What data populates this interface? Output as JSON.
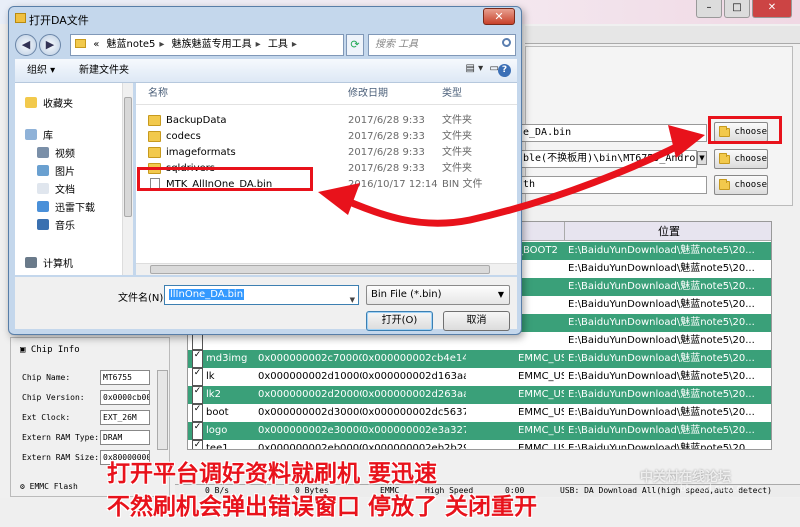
{
  "tool": {
    "table_header_location": "位置",
    "fields": [
      {
        "value": "e_DA.bin"
      },
      {
        "value": "ble(不换板用)\\bin\\MT6755_Android_scat"
      },
      {
        "value": "th"
      }
    ],
    "choose_label": "choose",
    "rows": [
      {
        "checked": false,
        "name": "",
        "begin": "",
        "end": "",
        "region": "_BOOT2",
        "location": "E:\\BaiduYunDownload\\魅蓝note5\\20..."
      },
      {
        "checked": false,
        "name": "",
        "begin": "",
        "end": "",
        "region": "",
        "location": "E:\\BaiduYunDownload\\魅蓝note5\\20..."
      },
      {
        "checked": false,
        "name": "",
        "begin": "",
        "end": "",
        "region": "",
        "location": "E:\\BaiduYunDownload\\魅蓝note5\\20..."
      },
      {
        "checked": false,
        "name": "",
        "begin": "",
        "end": "",
        "region": "",
        "location": "E:\\BaiduYunDownload\\魅蓝note5\\20..."
      },
      {
        "checked": false,
        "name": "",
        "begin": "",
        "end": "",
        "region": "",
        "location": "E:\\BaiduYunDownload\\魅蓝note5\\20..."
      },
      {
        "checked": false,
        "name": "",
        "begin": "",
        "end": "",
        "region": "",
        "location": "E:\\BaiduYunDownload\\魅蓝note5\\20..."
      },
      {
        "checked": true,
        "name": "md3img",
        "begin": "0x000000002c700000",
        "end": "0x000000002cb4e14f",
        "region": "EMMC_USER",
        "location": "E:\\BaiduYunDownload\\魅蓝note5\\20..."
      },
      {
        "checked": true,
        "name": "lk",
        "begin": "0x000000002d100000",
        "end": "0x000000002d163aaf",
        "region": "EMMC_USER",
        "location": "E:\\BaiduYunDownload\\魅蓝note5\\20..."
      },
      {
        "checked": true,
        "name": "lk2",
        "begin": "0x000000002d200000",
        "end": "0x000000002d263aaf",
        "region": "EMMC_USER",
        "location": "E:\\BaiduYunDownload\\魅蓝note5\\20..."
      },
      {
        "checked": true,
        "name": "boot",
        "begin": "0x000000002d300000",
        "end": "0x000000002dc5637f",
        "region": "EMMC_USER",
        "location": "E:\\BaiduYunDownload\\魅蓝note5\\20..."
      },
      {
        "checked": true,
        "name": "logo",
        "begin": "0x000000002e300000",
        "end": "0x000000002e3a327f",
        "region": "EMMC_USER",
        "location": "E:\\BaiduYunDownload\\魅蓝note5\\20..."
      },
      {
        "checked": true,
        "name": "tee1",
        "begin": "0x000000002eb00000",
        "end": "0x000000002eb2b29f",
        "region": "EMMC_USER",
        "location": "E:\\BaiduYunDownload\\魅蓝note5\\20..."
      }
    ],
    "chip_info": {
      "header": "Chip Info",
      "items": [
        {
          "label": "Chip Name:",
          "value": "MT6755"
        },
        {
          "label": "Chip Version:",
          "value": "0x0000cb00"
        },
        {
          "label": "Ext Clock:",
          "value": "EXT_26M"
        },
        {
          "label": "Extern RAM Type:",
          "value": "DRAM"
        },
        {
          "label": "Extern RAM Size:",
          "value": "0x80000000"
        }
      ],
      "emmc_label": "EMMC Flash"
    },
    "status": {
      "s1": "0 B/s",
      "s2": "0 Bytes",
      "s3": "EMMC",
      "s4": "High Speed",
      "s5": "0:00",
      "s6": "USB: DA Download All(high speed,auto detect)"
    }
  },
  "dialog": {
    "title": "打开DA文件",
    "breadcrumb": [
      "«",
      "魅蓝note5",
      "魅族魅蓝专用工具",
      "工具"
    ],
    "search_placeholder": "搜索 工具",
    "toolbar": {
      "organize": "组织 ▾",
      "new_folder": "新建文件夹"
    },
    "nav_items": [
      {
        "label": "收藏夹",
        "color": "#f2c94c"
      },
      {
        "label": "库",
        "color": "#8fb2d8"
      },
      {
        "label": "视频",
        "color": "#7a8fa8"
      },
      {
        "label": "图片",
        "color": "#6aa0d0"
      },
      {
        "label": "文档",
        "color": "#e0e6ee"
      },
      {
        "label": "迅雷下载",
        "color": "#4a90d9"
      },
      {
        "label": "音乐",
        "color": "#3a70b0"
      },
      {
        "label": "计算机",
        "color": "#6a7a8a"
      }
    ],
    "columns": {
      "name": "名称",
      "date": "修改日期",
      "type": "类型"
    },
    "files": [
      {
        "name": "BackupData",
        "date": "2017/6/28 9:33",
        "type": "文件夹",
        "kind": "folder"
      },
      {
        "name": "codecs",
        "date": "2017/6/28 9:33",
        "type": "文件夹",
        "kind": "folder"
      },
      {
        "name": "imageformats",
        "date": "2017/6/28 9:33",
        "type": "文件夹",
        "kind": "folder"
      },
      {
        "name": "sqldrivers",
        "date": "2017/6/28 9:33",
        "type": "文件夹",
        "kind": "folder"
      },
      {
        "name": "MTK_AllInOne_DA.bin",
        "date": "2016/10/17 12:14",
        "type": "BIN 文件",
        "kind": "file"
      }
    ],
    "filename_label": "文件名(N):",
    "filename_value": "llInOne_DA.bin",
    "filter_value": "Bin File (*.bin)",
    "open_label": "打开(O)",
    "cancel_label": "取消"
  },
  "annotations": {
    "caption_line1": "打开平台调好资料就刷机 要迅速",
    "caption_line2": "不然刷机会弹出错误窗口 停放了 关闭重开",
    "accent_color": "#e8121b"
  },
  "watermark": {
    "line1": "中关村在线论坛",
    "line2": "bbs.zol.com.cn"
  }
}
